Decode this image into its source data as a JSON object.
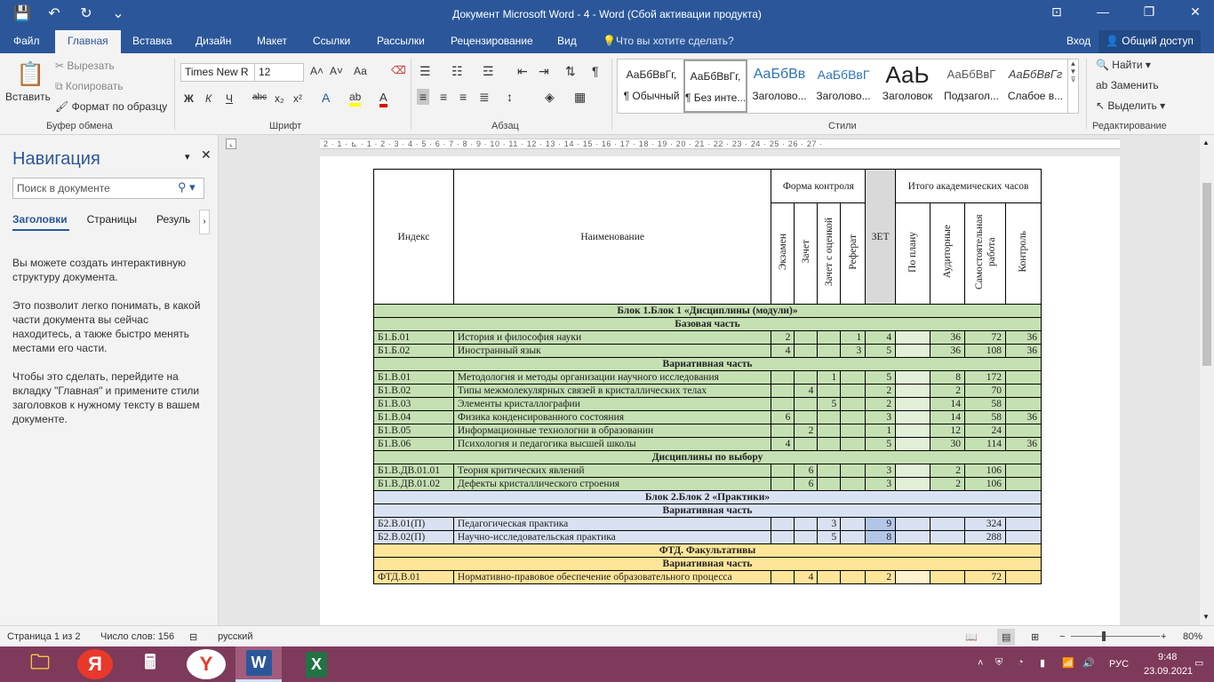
{
  "window": {
    "title": "Документ Microsoft Word - 4 - Word (Сбой активации продукта)",
    "controls": [
      "⊡",
      "—",
      "❐",
      "✕"
    ]
  },
  "qat": [
    "💾",
    "↶",
    "↻",
    "⌄"
  ],
  "tabs": [
    "Файл",
    "Главная",
    "Вставка",
    "Дизайн",
    "Макет",
    "Ссылки",
    "Рассылки",
    "Рецензирование",
    "Вид"
  ],
  "tell_me": "Что вы хотите сделать?",
  "sign_in": "Вход",
  "share": "Общий доступ",
  "ribbon": {
    "clipboard": {
      "paste": "Вставить",
      "cut": "Вырезать",
      "copy": "Копировать",
      "format_painter": "Формат по образцу",
      "label": "Буфер обмена"
    },
    "font": {
      "name": "Times New R",
      "size": "12",
      "label": "Шрифт",
      "bold": "Ж",
      "italic": "К",
      "underline": "Ч",
      "strike": "abc",
      "sub": "x₂",
      "sup": "x²",
      "aa": "Аа",
      "grow": "A˄",
      "shrink": "A˅"
    },
    "paragraph": {
      "label": "Абзац"
    },
    "styles": {
      "label": "Стили",
      "items": [
        {
          "preview": "АаБбВвГг,",
          "name": "¶ Обычный"
        },
        {
          "preview": "АаБбВвГг,",
          "name": "¶ Без инте..."
        },
        {
          "preview": "АаБбВв",
          "name": "Заголово..."
        },
        {
          "preview": "АаБбВвГ",
          "name": "Заголово..."
        },
        {
          "preview": "АаЬ",
          "name": "Заголовок"
        },
        {
          "preview": "АаБбВвГ",
          "name": "Подзагол..."
        },
        {
          "preview": "АаБбВвГг",
          "name": "Слабое в..."
        }
      ]
    },
    "editing": {
      "find": "Найти",
      "replace": "Заменить",
      "select": "Выделить",
      "label": "Редактирование"
    }
  },
  "nav": {
    "title": "Навигация",
    "search_placeholder": "Поиск в документе",
    "tabs": [
      "Заголовки",
      "Страницы",
      "Резуль"
    ],
    "p1": "Вы можете создать интерактивную структуру документа.",
    "p2": "Это позволит легко понимать, в какой части документа вы сейчас находитесь, а также быстро менять местами его части.",
    "p3": "Чтобы это сделать, перейдите на вкладку \"Главная\" и примените стили заголовков к нужному тексту в вашем документе."
  },
  "ruler_text": "2 · 1 · ⊾ · 1 · 2 · 3 · 4 · 5 · 6 · 7 · 8 · 9 · 10 · 11 · 12 · 13 · 14 · 15 · 16 · 17 · 18 · 19 · 20 · 21 · 22 · 23 · 24 · 25 · 26 · 27 ·",
  "table": {
    "header": {
      "index": "Индекс",
      "name": "Наименование",
      "forma": "Форма контроля",
      "zet": "ЗЕТ",
      "itogo": "Итого академических часов",
      "exam": "Экзамен",
      "zachet": "Зачет",
      "zachet_ocenka": "Зачет с оценкой",
      "referat": "Реферат",
      "po_planu": "По плану",
      "auditornye": "Аудиторные",
      "samost": "Самостоятельная работа",
      "kontrol": "Контроль"
    },
    "block1": "Блок 1.Блок 1 «Дисциплины (модули)»",
    "base": "Базовая часть",
    "var1": "Вариативная часть",
    "elective": "Дисциплины по выбору",
    "block2": "Блок 2.Блок 2 «Практики»",
    "var2": "Вариативная часть",
    "ftd": "ФТД. Факультативы",
    "var3": "Вариативная часть",
    "rows_base": [
      {
        "idx": "Б1.Б.01",
        "name": "История и философия науки",
        "ex": "2",
        "z": "",
        "zo": "",
        "ref": "1",
        "zet": "4",
        "plan": "",
        "aud": "36",
        "sam": "72",
        "kon": "36"
      },
      {
        "idx": "Б1.Б.02",
        "name": "Иностранный язык",
        "ex": "4",
        "z": "",
        "zo": "",
        "ref": "3",
        "zet": "5",
        "plan": "",
        "aud": "36",
        "sam": "108",
        "kon": "36"
      }
    ],
    "rows_var": [
      {
        "idx": "Б1.В.01",
        "name": "Методология и методы организации научного исследования",
        "ex": "",
        "z": "",
        "zo": "1",
        "ref": "",
        "zet": "5",
        "plan": "",
        "aud": "8",
        "sam": "172",
        "kon": ""
      },
      {
        "idx": "Б1.В.02",
        "name": "Типы межмолекулярных связей в кристаллических телах",
        "ex": "",
        "z": "4",
        "zo": "",
        "ref": "",
        "zet": "2",
        "plan": "",
        "aud": "2",
        "sam": "70",
        "kon": ""
      },
      {
        "idx": "Б1.В.03",
        "name": "Элементы кристаллографии",
        "ex": "",
        "z": "",
        "zo": "5",
        "ref": "",
        "zet": "2",
        "plan": "",
        "aud": "14",
        "sam": "58",
        "kon": ""
      },
      {
        "idx": "Б1.В.04",
        "name": "Физика конденсированного состояния",
        "ex": "6",
        "z": "",
        "zo": "",
        "ref": "",
        "zet": "3",
        "plan": "",
        "aud": "14",
        "sam": "58",
        "kon": "36"
      },
      {
        "idx": "Б1.В.05",
        "name": "Информационные технологии в образовании",
        "ex": "",
        "z": "2",
        "zo": "",
        "ref": "",
        "zet": "1",
        "plan": "",
        "aud": "12",
        "sam": "24",
        "kon": ""
      },
      {
        "idx": "Б1.В.06",
        "name": "Психология и педагогика высшей школы",
        "ex": "4",
        "z": "",
        "zo": "",
        "ref": "",
        "zet": "5",
        "plan": "",
        "aud": "30",
        "sam": "114",
        "kon": "36"
      }
    ],
    "rows_dv": [
      {
        "idx": "Б1.В.ДВ.01.01",
        "name": "Теория критических явлений",
        "ex": "",
        "z": "6",
        "zo": "",
        "ref": "",
        "zet": "3",
        "plan": "",
        "aud": "2",
        "sam": "106",
        "kon": ""
      },
      {
        "idx": "Б1.В.ДВ.01.02",
        "name": "Дефекты кристаллического строения",
        "ex": "",
        "z": "6",
        "zo": "",
        "ref": "",
        "zet": "3",
        "plan": "",
        "aud": "2",
        "sam": "106",
        "kon": ""
      }
    ],
    "rows_b2": [
      {
        "idx": "Б2.В.01(П)",
        "name": "Педагогическая практика",
        "ex": "",
        "z": "",
        "zo": "3",
        "ref": "",
        "zet": "9",
        "plan": "",
        "aud": "",
        "sam": "324",
        "kon": ""
      },
      {
        "idx": "Б2.В.02(П)",
        "name": "Научно-исследовательская практика",
        "ex": "",
        "z": "",
        "zo": "5",
        "ref": "",
        "zet": "8",
        "plan": "",
        "aud": "",
        "sam": "288",
        "kon": ""
      }
    ],
    "rows_ftd": [
      {
        "idx": "ФТД.В.01",
        "name": "Нормативно-правовое обеспечение образовательного процесса",
        "ex": "",
        "z": "4",
        "zo": "",
        "ref": "",
        "zet": "2",
        "plan": "",
        "aud": "",
        "sam": "72",
        "kon": ""
      }
    ]
  },
  "status": {
    "page": "Страница 1 из 2",
    "words": "Число слов: 156",
    "lang": "русский",
    "zoom": "80%"
  },
  "taskbar": {
    "lang": "РУС",
    "time": "9:48",
    "date": "23.09.2021"
  }
}
